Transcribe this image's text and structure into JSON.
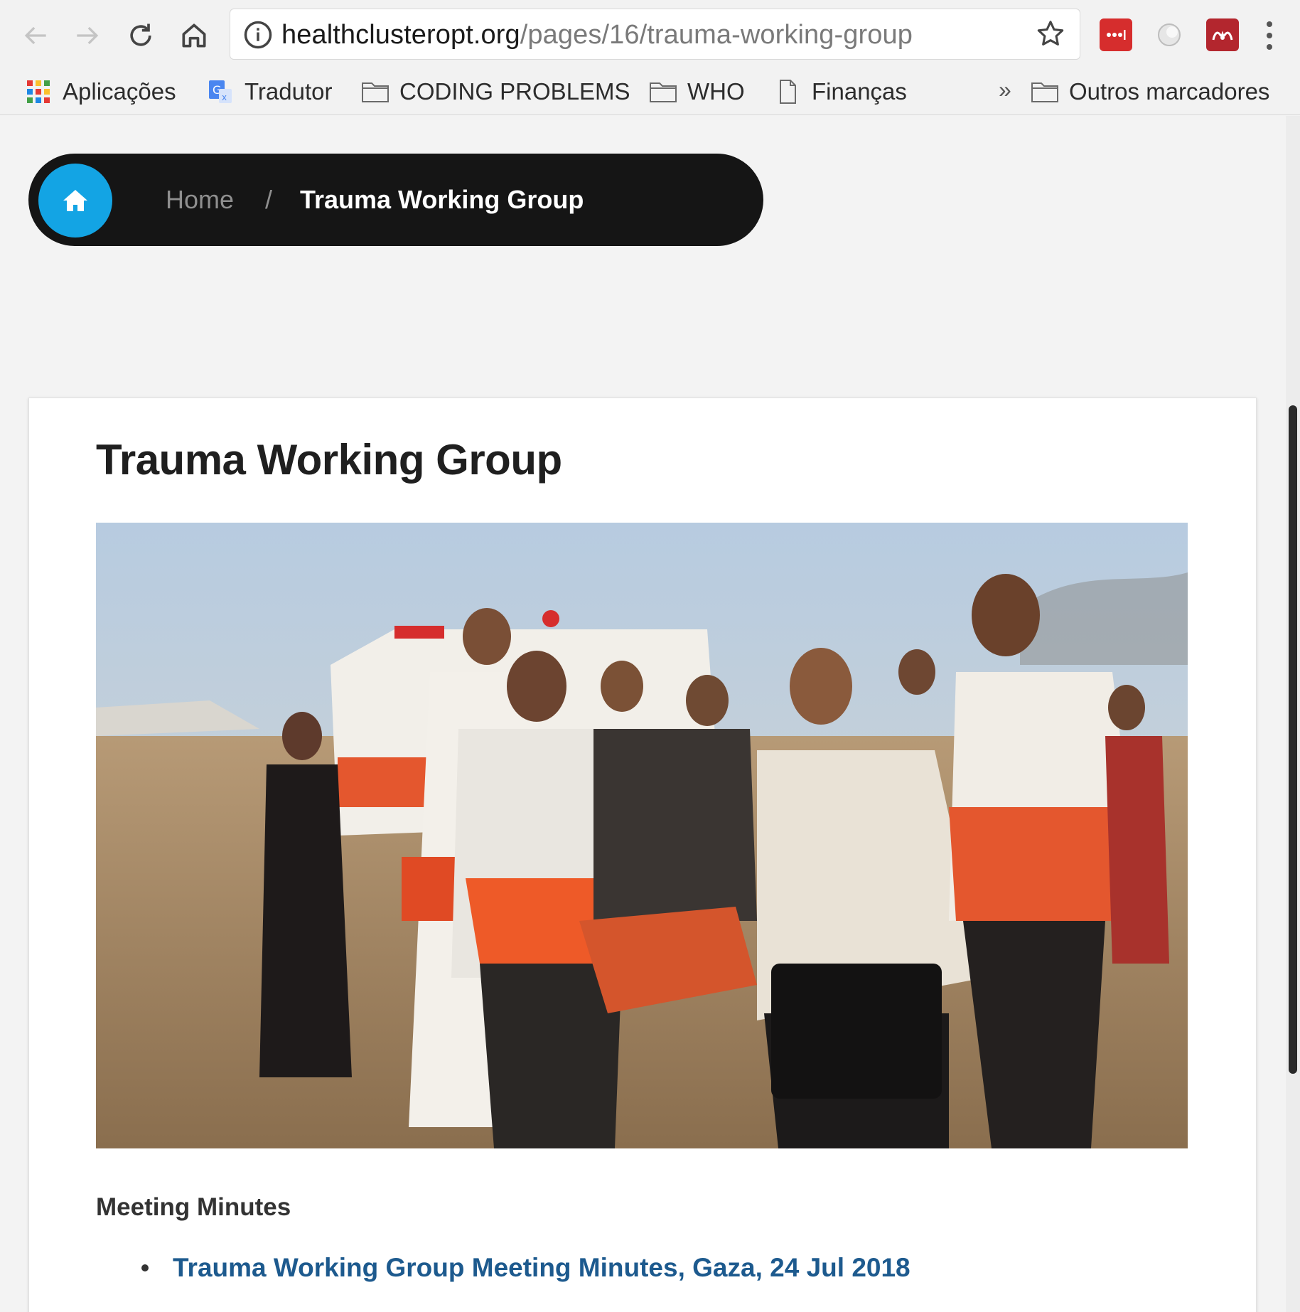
{
  "browser": {
    "url_host": "healthclusteropt.org",
    "url_path": "/pages/16/trauma-working-group",
    "bookmarks": [
      {
        "label": "Aplicações",
        "icon": "apps-grid-icon"
      },
      {
        "label": "Tradutor",
        "icon": "translate-icon"
      },
      {
        "label": "CODING PROBLEMS",
        "icon": "folder-icon"
      },
      {
        "label": "WHO",
        "icon": "folder-icon"
      },
      {
        "label": "Finanças",
        "icon": "page-icon"
      }
    ],
    "overflow_label": "»",
    "other_bookmarks": {
      "label": "Outros marcadores",
      "icon": "folder-icon"
    }
  },
  "breadcrumb": {
    "home_label": "Home",
    "separator": "/",
    "current_label": "Trauma Working Group"
  },
  "main": {
    "title": "Trauma Working Group",
    "section_label": "Meeting Minutes",
    "minutes": [
      {
        "label": "Trauma Working Group Meeting Minutes, Gaza, 24 Jul 2018"
      }
    ]
  },
  "colors": {
    "accent": "#13a4e4",
    "breadcrumb_bg": "#151515",
    "link": "#1d5a8e"
  }
}
